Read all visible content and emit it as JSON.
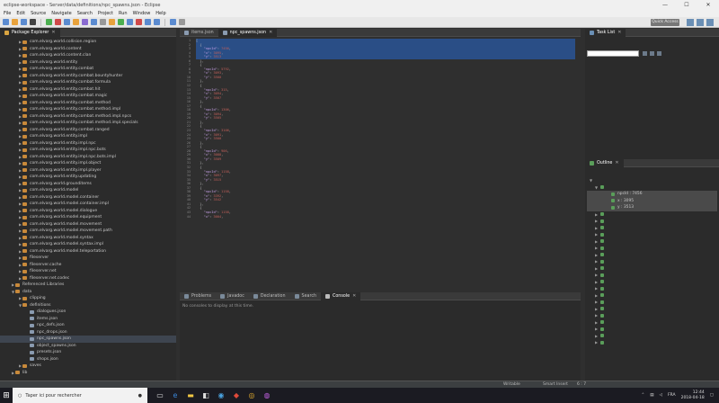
{
  "window": {
    "title": "eclipse-workspace - Server/data/definitions/npc_spawns.json - Eclipse",
    "controls": [
      "—",
      "☐",
      "✕"
    ]
  },
  "menu": [
    "File",
    "Edit",
    "Source",
    "Navigate",
    "Search",
    "Project",
    "Run",
    "Window",
    "Help"
  ],
  "quick_access": "Quick Access",
  "package_explorer": {
    "tab": "Package Explorer",
    "rows": [
      {
        "label": "com.elvarg.world.collision.region",
        "depth": 2,
        "arrow": "▶",
        "sel": false
      },
      {
        "label": "com.elvarg.world.content",
        "depth": 2,
        "arrow": "▶",
        "sel": false
      },
      {
        "label": "com.elvarg.world.content.clan",
        "depth": 2,
        "arrow": "▶",
        "sel": false
      },
      {
        "label": "com.elvarg.world.entity",
        "depth": 2,
        "arrow": "▶",
        "sel": false
      },
      {
        "label": "com.elvarg.world.entity.combat",
        "depth": 2,
        "arrow": "▶",
        "sel": false
      },
      {
        "label": "com.elvarg.world.entity.combat.bountyhunter",
        "depth": 2,
        "arrow": "▶",
        "sel": false
      },
      {
        "label": "com.elvarg.world.entity.combat.formula",
        "depth": 2,
        "arrow": "▶",
        "sel": false
      },
      {
        "label": "com.elvarg.world.entity.combat.hit",
        "depth": 2,
        "arrow": "▶",
        "sel": false
      },
      {
        "label": "com.elvarg.world.entity.combat.magic",
        "depth": 2,
        "arrow": "▶",
        "sel": false
      },
      {
        "label": "com.elvarg.world.entity.combat.method",
        "depth": 2,
        "arrow": "▶",
        "sel": false
      },
      {
        "label": "com.elvarg.world.entity.combat.method.impl",
        "depth": 2,
        "arrow": "▶",
        "sel": false
      },
      {
        "label": "com.elvarg.world.entity.combat.method.impl.npcs",
        "depth": 2,
        "arrow": "▶",
        "sel": false
      },
      {
        "label": "com.elvarg.world.entity.combat.method.impl.specials",
        "depth": 2,
        "arrow": "▶",
        "sel": false
      },
      {
        "label": "com.elvarg.world.entity.combat.ranged",
        "depth": 2,
        "arrow": "▶",
        "sel": false
      },
      {
        "label": "com.elvarg.world.entity.impl",
        "depth": 2,
        "arrow": "▶",
        "sel": false
      },
      {
        "label": "com.elvarg.world.entity.impl.npc",
        "depth": 2,
        "arrow": "▶",
        "sel": false
      },
      {
        "label": "com.elvarg.world.entity.impl.npc.bots",
        "depth": 2,
        "arrow": "▶",
        "sel": false
      },
      {
        "label": "com.elvarg.world.entity.impl.npc.bots.impl",
        "depth": 2,
        "arrow": "▶",
        "sel": false
      },
      {
        "label": "com.elvarg.world.entity.impl.object",
        "depth": 2,
        "arrow": "▶",
        "sel": false
      },
      {
        "label": "com.elvarg.world.entity.impl.player",
        "depth": 2,
        "arrow": "▶",
        "sel": false
      },
      {
        "label": "com.elvarg.world.entity.updating",
        "depth": 2,
        "arrow": "▶",
        "sel": false
      },
      {
        "label": "com.elvarg.world.grounditems",
        "depth": 2,
        "arrow": "▶",
        "sel": false
      },
      {
        "label": "com.elvarg.world.model",
        "depth": 2,
        "arrow": "▶",
        "sel": false
      },
      {
        "label": "com.elvarg.world.model.container",
        "depth": 2,
        "arrow": "▶",
        "sel": false
      },
      {
        "label": "com.elvarg.world.model.container.impl",
        "depth": 2,
        "arrow": "▶",
        "sel": false
      },
      {
        "label": "com.elvarg.world.model.dialogue",
        "depth": 2,
        "arrow": "▶",
        "sel": false
      },
      {
        "label": "com.elvarg.world.model.equipment",
        "depth": 2,
        "arrow": "▶",
        "sel": false
      },
      {
        "label": "com.elvarg.world.model.movement",
        "depth": 2,
        "arrow": "▶",
        "sel": false
      },
      {
        "label": "com.elvarg.world.model.movement.path",
        "depth": 2,
        "arrow": "▶",
        "sel": false
      },
      {
        "label": "com.elvarg.world.model.syntax",
        "depth": 2,
        "arrow": "▶",
        "sel": false
      },
      {
        "label": "com.elvarg.world.model.syntax.impl",
        "depth": 2,
        "arrow": "▶",
        "sel": false
      },
      {
        "label": "com.elvarg.world.model.teleportation",
        "depth": 2,
        "arrow": "▶",
        "sel": false
      },
      {
        "label": "fileserver",
        "depth": 2,
        "arrow": "▶",
        "sel": false
      },
      {
        "label": "fileserver.cache",
        "depth": 2,
        "arrow": "▶",
        "sel": false
      },
      {
        "label": "fileserver.net",
        "depth": 2,
        "arrow": "▶",
        "sel": false
      },
      {
        "label": "fileserver.net.codec",
        "depth": 2,
        "arrow": "▶",
        "sel": false
      },
      {
        "label": "Referenced Libraries",
        "depth": 1,
        "arrow": "▶",
        "sel": false
      },
      {
        "label": "data",
        "depth": 1,
        "arrow": "▼",
        "sel": false
      },
      {
        "label": "clipping",
        "depth": 2,
        "arrow": "▶",
        "sel": false
      },
      {
        "label": "definitions",
        "depth": 2,
        "arrow": "▼",
        "sel": false
      },
      {
        "label": "dialogues.json",
        "depth": 3,
        "arrow": "",
        "sel": false
      },
      {
        "label": "items.json",
        "depth": 3,
        "arrow": "",
        "sel": false
      },
      {
        "label": "npc_defs.json",
        "depth": 3,
        "arrow": "",
        "sel": false
      },
      {
        "label": "npc_drops.json",
        "depth": 3,
        "arrow": "",
        "sel": false
      },
      {
        "label": "npc_spawns.json",
        "depth": 3,
        "arrow": "",
        "sel": true
      },
      {
        "label": "object_spawns.json",
        "depth": 3,
        "arrow": "",
        "sel": false
      },
      {
        "label": "presets.json",
        "depth": 3,
        "arrow": "",
        "sel": false
      },
      {
        "label": "shops.json",
        "depth": 3,
        "arrow": "",
        "sel": false
      },
      {
        "label": "saves",
        "depth": 2,
        "arrow": "▶",
        "sel": false
      },
      {
        "label": "lib",
        "depth": 1,
        "arrow": "▶",
        "sel": false
      }
    ]
  },
  "editor": {
    "tabs": [
      {
        "label": "items.json",
        "active": false
      },
      {
        "label": "npc_spawns.json",
        "active": true
      }
    ],
    "lines": [
      {
        "n": "1",
        "t": "[",
        "hl": true,
        "f": true
      },
      {
        "n": "2",
        "t": "  {",
        "hl": true,
        "f": true
      },
      {
        "n": "3",
        "t": "    \"npcId\": 7456,",
        "hl": true,
        "f": false
      },
      {
        "n": "4",
        "t": "    \"x\": 3095,",
        "hl": true,
        "f": false
      },
      {
        "n": "5",
        "t": "    \"y\": 3513",
        "hl": true,
        "f": false
      },
      {
        "n": "6",
        "t": "  },",
        "hl": false,
        "f": false
      },
      {
        "n": "7",
        "t": "  {",
        "hl": false,
        "f": true
      },
      {
        "n": "8",
        "t": "    \"npcId\": 5792,",
        "hl": false,
        "f": false
      },
      {
        "n": "9",
        "t": "    \"x\": 3093,",
        "hl": false,
        "f": false
      },
      {
        "n": "10",
        "t": "    \"y\": 3500",
        "hl": false,
        "f": false
      },
      {
        "n": "11",
        "t": "  },",
        "hl": false,
        "f": false
      },
      {
        "n": "12",
        "t": "  {",
        "hl": false,
        "f": true
      },
      {
        "n": "13",
        "t": "    \"npcId\": 315,",
        "hl": false,
        "f": false
      },
      {
        "n": "14",
        "t": "    \"x\": 3094,",
        "hl": false,
        "f": false
      },
      {
        "n": "15",
        "t": "    \"y\": 3507",
        "hl": false,
        "f": false
      },
      {
        "n": "16",
        "t": "  },",
        "hl": false,
        "f": false
      },
      {
        "n": "17",
        "t": "  {",
        "hl": false,
        "f": true
      },
      {
        "n": "18",
        "t": "    \"npcId\": 1306,",
        "hl": false,
        "f": false
      },
      {
        "n": "19",
        "t": "    \"x\": 3094,",
        "hl": false,
        "f": false
      },
      {
        "n": "20",
        "t": "    \"y\": 3505",
        "hl": false,
        "f": false
      },
      {
        "n": "21",
        "t": "  },",
        "hl": false,
        "f": false
      },
      {
        "n": "22",
        "t": "  {",
        "hl": false,
        "f": true
      },
      {
        "n": "23",
        "t": "    \"npcId\": 3106,",
        "hl": false,
        "f": false
      },
      {
        "n": "24",
        "t": "    \"x\": 3091,",
        "hl": false,
        "f": false
      },
      {
        "n": "25",
        "t": "    \"y\": 3500",
        "hl": false,
        "f": false
      },
      {
        "n": "26",
        "t": "  },",
        "hl": false,
        "f": false
      },
      {
        "n": "27",
        "t": "  {",
        "hl": false,
        "f": true
      },
      {
        "n": "28",
        "t": "    \"npcId\": 906,",
        "hl": false,
        "f": false
      },
      {
        "n": "29",
        "t": "    \"x\": 3088,",
        "hl": false,
        "f": false
      },
      {
        "n": "30",
        "t": "    \"y\": 3509",
        "hl": false,
        "f": false
      },
      {
        "n": "31",
        "t": "  },",
        "hl": false,
        "f": false
      },
      {
        "n": "32",
        "t": "  {",
        "hl": false,
        "f": true
      },
      {
        "n": "33",
        "t": "    \"npcId\": 1158,",
        "hl": false,
        "f": false
      },
      {
        "n": "34",
        "t": "    \"x\": 3097,",
        "hl": false,
        "f": false
      },
      {
        "n": "35",
        "t": "    \"y\": 3515",
        "hl": false,
        "f": false
      },
      {
        "n": "36",
        "t": "  },",
        "hl": false,
        "f": false
      },
      {
        "n": "37",
        "t": "  {",
        "hl": false,
        "f": true
      },
      {
        "n": "38",
        "t": "    \"npcId\": 1158,",
        "hl": false,
        "f": false
      },
      {
        "n": "39",
        "t": "    \"x\": 3392,",
        "hl": false,
        "f": false
      },
      {
        "n": "40",
        "t": "    \"y\": 3542",
        "hl": false,
        "f": false
      },
      {
        "n": "41",
        "t": "  },",
        "hl": false,
        "f": false
      },
      {
        "n": "42",
        "t": "  {",
        "hl": false,
        "f": true
      },
      {
        "n": "43",
        "t": "    \"npcId\": 1158,",
        "hl": false,
        "f": false
      },
      {
        "n": "44",
        "t": "    \"x\": 3004,",
        "hl": false,
        "f": false
      }
    ]
  },
  "task_list": {
    "tab": "Task List",
    "find_placeholder": ""
  },
  "outline": {
    "tab": "Outline",
    "rows": [
      {
        "label": "",
        "arr": "▼",
        "sel": false,
        "dot": false,
        "ind": 2
      },
      {
        "label": "",
        "arr": "▼",
        "sel": false,
        "dot": true,
        "ind": 8
      },
      {
        "label": "npcId : 7456",
        "arr": "",
        "sel": true,
        "dot": true,
        "ind": 20
      },
      {
        "label": "x : 3095",
        "arr": "",
        "sel": true,
        "dot": true,
        "ind": 20
      },
      {
        "label": "y : 3513",
        "arr": "",
        "sel": true,
        "dot": true,
        "ind": 20
      },
      {
        "label": "",
        "arr": "▶",
        "sel": false,
        "dot": true,
        "ind": 8
      },
      {
        "label": "",
        "arr": "▶",
        "sel": false,
        "dot": true,
        "ind": 8
      },
      {
        "label": "",
        "arr": "▶",
        "sel": false,
        "dot": true,
        "ind": 8
      },
      {
        "label": "",
        "arr": "▶",
        "sel": false,
        "dot": true,
        "ind": 8
      },
      {
        "label": "",
        "arr": "▶",
        "sel": false,
        "dot": true,
        "ind": 8
      },
      {
        "label": "",
        "arr": "▶",
        "sel": false,
        "dot": true,
        "ind": 8
      },
      {
        "label": "",
        "arr": "▶",
        "sel": false,
        "dot": true,
        "ind": 8
      },
      {
        "label": "",
        "arr": "▶",
        "sel": false,
        "dot": true,
        "ind": 8
      },
      {
        "label": "",
        "arr": "▶",
        "sel": false,
        "dot": true,
        "ind": 8
      },
      {
        "label": "",
        "arr": "▶",
        "sel": false,
        "dot": true,
        "ind": 8
      },
      {
        "label": "",
        "arr": "▶",
        "sel": false,
        "dot": true,
        "ind": 8
      },
      {
        "label": "",
        "arr": "▶",
        "sel": false,
        "dot": true,
        "ind": 8
      },
      {
        "label": "",
        "arr": "▶",
        "sel": false,
        "dot": true,
        "ind": 8
      },
      {
        "label": "",
        "arr": "▶",
        "sel": false,
        "dot": true,
        "ind": 8
      },
      {
        "label": "",
        "arr": "▶",
        "sel": false,
        "dot": true,
        "ind": 8
      },
      {
        "label": "",
        "arr": "▶",
        "sel": false,
        "dot": true,
        "ind": 8
      },
      {
        "label": "",
        "arr": "▶",
        "sel": false,
        "dot": true,
        "ind": 8
      },
      {
        "label": "",
        "arr": "▶",
        "sel": false,
        "dot": true,
        "ind": 8
      },
      {
        "label": "",
        "arr": "▶",
        "sel": false,
        "dot": true,
        "ind": 8
      },
      {
        "label": "",
        "arr": "▶",
        "sel": false,
        "dot": true,
        "ind": 8
      }
    ]
  },
  "console": {
    "tabs": [
      {
        "label": "Problems",
        "active": false
      },
      {
        "label": "Javadoc",
        "active": false
      },
      {
        "label": "Declaration",
        "active": false
      },
      {
        "label": "Search",
        "active": false
      },
      {
        "label": "Console",
        "active": true
      }
    ],
    "message": "No consoles to display at this time."
  },
  "status": {
    "writable": "Writable",
    "insert": "Smart Insert",
    "position": "6 : 7"
  },
  "taskbar": {
    "search_placeholder": "Taper ici pour rechercher",
    "lang": "FRA",
    "time": "12:44",
    "date": "2018-04-18"
  },
  "colors": {
    "accent": "#2a4e86",
    "selection": "#3e4550",
    "keyword": "#c6a0e6",
    "number": "#c2605a"
  }
}
